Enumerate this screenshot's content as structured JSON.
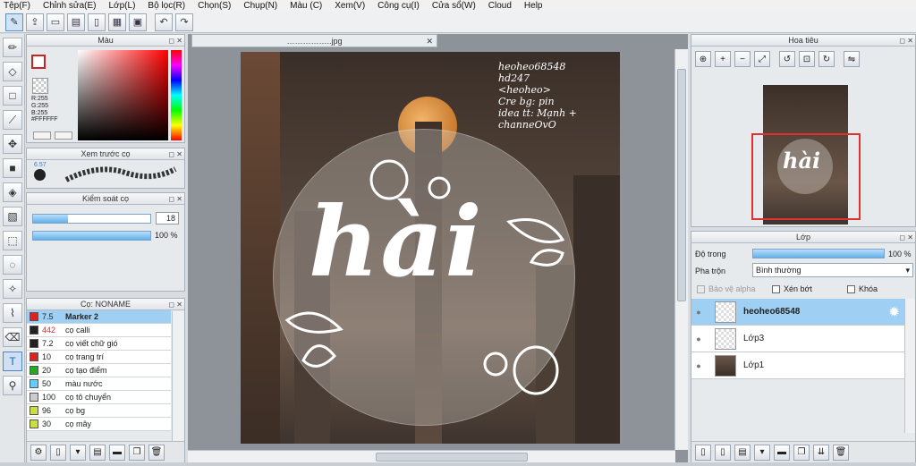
{
  "menu": [
    "Tệp(F)",
    "Chỉnh sửa(E)",
    "Lớp(L)",
    "Bộ lọc(R)",
    "Chọn(S)",
    "Chụp(N)",
    "Màu (C)",
    "Xem(V)",
    "Công cụ(I)",
    "Cửa sổ(W)",
    "Cloud",
    "Help"
  ],
  "color_panel": {
    "title": "Màu",
    "r": "R:255",
    "g": "G:255",
    "b": "B:255",
    "hex": "#FFFFFF",
    "fg": "#cc2222",
    "bg": "#8888cc"
  },
  "brush_preview": {
    "title": "Xem trước cọ",
    "size": "6.57"
  },
  "brush_control": {
    "title": "Kiểm soát cọ",
    "size_value": "18",
    "opacity_value": "100 %",
    "size_fraction": 0.3,
    "opacity_fraction": 1.0
  },
  "brush_list": {
    "title": "Cọ: NONAME",
    "items": [
      {
        "num": "7.5",
        "name": "Marker 2",
        "color": "#dd2222"
      },
      {
        "num": "442",
        "name": "cọ calli",
        "color": "#222222"
      },
      {
        "num": "7.2",
        "name": "cọ viết chữ gió",
        "color": "#222222"
      },
      {
        "num": "10",
        "name": "cọ trang trí",
        "color": "#dd2222"
      },
      {
        "num": "20",
        "name": "cọ tạo điểm",
        "color": "#22aa22"
      },
      {
        "num": "50",
        "name": "màu nước",
        "color": "#66ccff"
      },
      {
        "num": "100",
        "name": "cọ tô chuyển",
        "color": "#cccccc"
      },
      {
        "num": "96",
        "name": "cọ bg",
        "color": "#ccdd44"
      },
      {
        "num": "30",
        "name": "cọ mây",
        "color": "#ccdd44"
      }
    ]
  },
  "document": {
    "tab": "……………..jpg"
  },
  "artwork": {
    "credits": [
      "heoheo68548",
      "hd247",
      "<heoheo>",
      "Cre bg: pin",
      "idea tt: Mạnh + channeOvO"
    ],
    "word": "hài"
  },
  "navigator": {
    "title": "Hoa tiêu"
  },
  "layers": {
    "title": "Lớp",
    "opacity_label": "Độ trong",
    "opacity_value": "100 %",
    "opacity_fraction": 1.0,
    "blend_label": "Pha trộn",
    "blend_value": "Bình thường",
    "protect_alpha": "Bảo vệ alpha",
    "clipping": "Xén bớt",
    "lock": "Khóa",
    "items": [
      {
        "name": "heoheo68548",
        "selected": true
      },
      {
        "name": "Lớp3",
        "selected": false
      },
      {
        "name": "Lớp1",
        "selected": false
      }
    ]
  }
}
